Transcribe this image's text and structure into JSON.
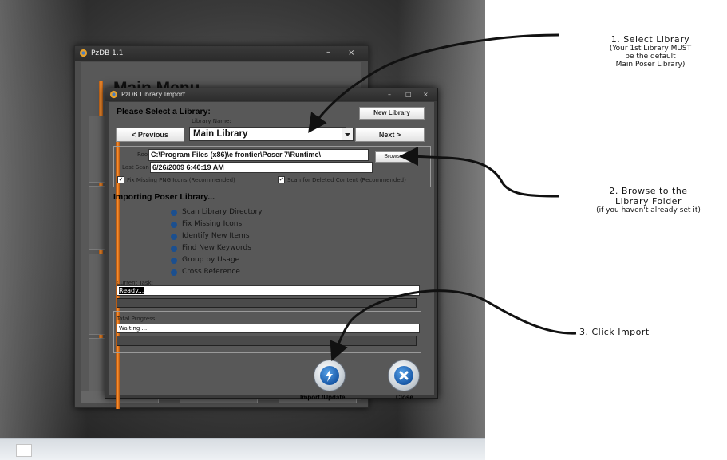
{
  "main_window": {
    "title": "PzDB 1.1",
    "minimize": "–",
    "close": "×",
    "heading": "Main Menu"
  },
  "dialog": {
    "title": "PzDB Library Import",
    "controls": {
      "minimize": "–",
      "maximize": "□",
      "close": "×"
    },
    "select_heading": "Please Select a Library:",
    "new_library": "New Library",
    "library_name_label": "Library Name:",
    "library_name_value": "Main Library",
    "previous": "< Previous",
    "next": "Next >",
    "root_path_label": "Root Path:",
    "root_path_value": "C:\\Program Files (x86)\\e frontier\\Poser 7\\Runtime\\",
    "browse": "Browse",
    "last_scan_label": "Last Scan Date:",
    "last_scan_value": "6/26/2009 6:40:19 AM",
    "fix_png_label": "Fix Missing PNG Icons (Recommended)",
    "scan_deleted_label": "Scan for Deleted Content (Recommended)",
    "check_mark": "✓",
    "importing_heading": "Importing Poser Library...",
    "steps": [
      "Scan Library Directory",
      "Fix Missing Icons",
      "Identify New Items",
      "Find New Keywords",
      "Group by Usage",
      "Cross Reference"
    ],
    "current_task_label": "Current Task:",
    "current_task_value": "Ready...",
    "total_progress_label": "Total Progress:",
    "total_progress_value": "Waiting ...",
    "import_label": "Import /Update",
    "close_label": "Close"
  },
  "annotations": {
    "step1_title": "1. Select Library",
    "step1_line1": "(Your 1st Library MUST",
    "step1_line2": "be the default",
    "step1_line3": "Main Poser Library)",
    "step2_title_line1": "2. Browse to the",
    "step2_title_line2": "Library Folder",
    "step2_sub": "(if you haven't already set it)",
    "step3_title": "3. Click Import"
  },
  "colors": {
    "accent_orange": "#ff9a3a",
    "step_dot_blue": "#1b4f8f",
    "button_blue": "#1859a8"
  }
}
